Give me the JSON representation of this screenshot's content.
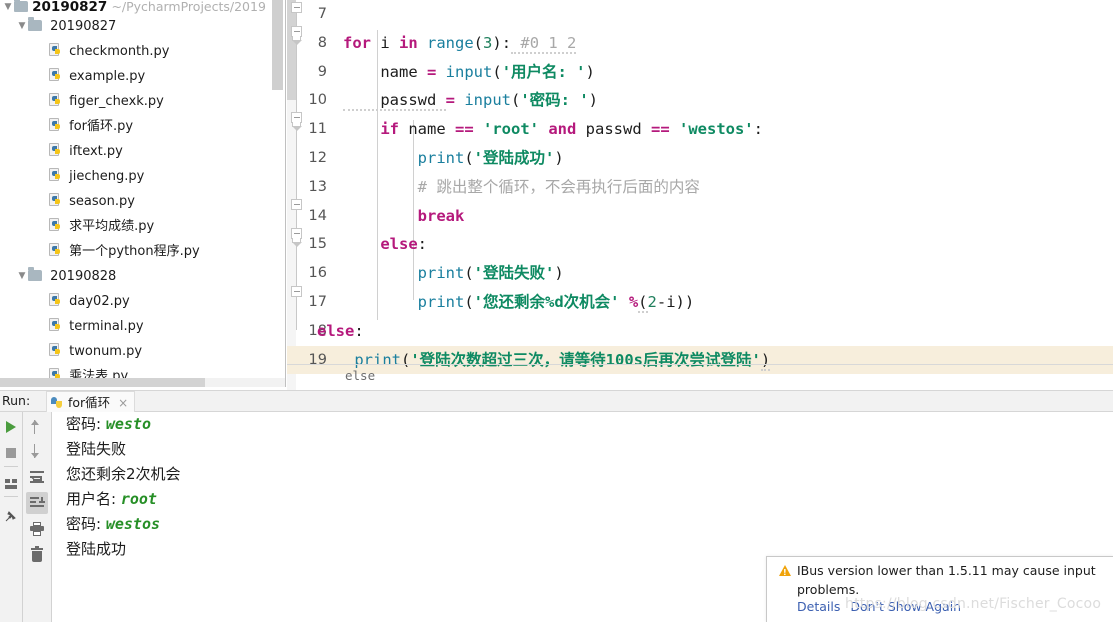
{
  "project": {
    "root": {
      "name": "20190827",
      "path": "~/PycharmProjects/2019",
      "arrow": "chevron-down-icon"
    },
    "nodes": [
      {
        "type": "folder",
        "label": "20190827",
        "indent": 1,
        "arrow": "chevron-down-icon"
      },
      {
        "type": "file",
        "label": "checkmonth.py",
        "indent": 2
      },
      {
        "type": "file",
        "label": "example.py",
        "indent": 2
      },
      {
        "type": "file",
        "label": "figer_chexk.py",
        "indent": 2
      },
      {
        "type": "file",
        "label": "for循环.py",
        "indent": 2
      },
      {
        "type": "file",
        "label": "iftext.py",
        "indent": 2
      },
      {
        "type": "file",
        "label": "jiecheng.py",
        "indent": 2
      },
      {
        "type": "file",
        "label": "season.py",
        "indent": 2
      },
      {
        "type": "file",
        "label": "求平均成绩.py",
        "indent": 2
      },
      {
        "type": "file",
        "label": "第一个python程序.py",
        "indent": 2
      },
      {
        "type": "folder",
        "label": "20190828",
        "indent": 1,
        "arrow": "chevron-down-icon"
      },
      {
        "type": "file",
        "label": "day02.py",
        "indent": 2
      },
      {
        "type": "file",
        "label": "terminal.py",
        "indent": 2
      },
      {
        "type": "file",
        "label": "twonum.py",
        "indent": 2
      },
      {
        "type": "file",
        "label": "乘法表.py",
        "indent": 2
      }
    ]
  },
  "editor": {
    "lines": [
      {
        "num": "7",
        "highlight": false
      },
      {
        "num": "8",
        "highlight": false
      },
      {
        "num": "9",
        "highlight": false
      },
      {
        "num": "10",
        "highlight": false
      },
      {
        "num": "11",
        "highlight": false
      },
      {
        "num": "12",
        "highlight": false
      },
      {
        "num": "13",
        "highlight": false
      },
      {
        "num": "14",
        "highlight": false
      },
      {
        "num": "15",
        "highlight": false
      },
      {
        "num": "16",
        "highlight": false
      },
      {
        "num": "17",
        "highlight": false
      },
      {
        "num": "18",
        "highlight": false
      },
      {
        "num": "19",
        "highlight": true
      }
    ],
    "source": {
      "l7": "",
      "l8_kw_for": "for",
      "l8_var_i": " i ",
      "l8_kw_in": "in",
      "l8_fn_range": " range",
      "l8_paren_open": "(",
      "l8_num3": "3",
      "l8_paren_close": ")",
      "l8_colon": ":",
      "l8_comment": " #0 1 2",
      "l9_name": "    name ",
      "l9_eq": "=",
      "l9_input": " input",
      "l9_p1": "(",
      "l9_str": "'用户名: '",
      "l9_p2": ")",
      "l10_passwd": "    passwd ",
      "l10_eq": "=",
      "l10_input": " input",
      "l10_p1": "(",
      "l10_str": "'密码: '",
      "l10_p2": ")",
      "l11_if": "    if",
      "l11_name": " name ",
      "l11_eqeq": "==",
      "l11_root": " 'root' ",
      "l11_and": "and",
      "l11_passwd": " passwd ",
      "l11_eqeq2": "==",
      "l11_westos": " 'westos'",
      "l11_colon": ":",
      "l12_print": "        print",
      "l12_p1": "(",
      "l12_str": "'登陆成功'",
      "l12_p2": ")",
      "l13_comment": "        # 跳出整个循环，不会再执行后面的内容",
      "l14_break": "        break",
      "l15_else": "    else",
      "l15_colon": ":",
      "l16_print": "        print",
      "l16_p1": "(",
      "l16_str": "'登陆失败'",
      "l16_p2": ")",
      "l17_print": "        print",
      "l17_p1": "(",
      "l17_str": "'您还剩余%d次机会'",
      "l17_pct": " %",
      "l17_p2": "(",
      "l17_num2": "2",
      "l17_minus": "-",
      "l17_i": "i",
      "l17_p3": "))",
      "l18_else": "else",
      "l18_colon": ":",
      "l19_print": "    print",
      "l19_p1": "(",
      "l19_str": "'登陆次数超过三次，请等待100s后再次尝试登陆'",
      "l19_p2": ")",
      "after": "else"
    }
  },
  "run_panel": {
    "label": "Run:",
    "tab_name": "for循环",
    "tab_close": "×",
    "toolbar_left": [
      {
        "name": "run-button",
        "icon": "play-icon"
      },
      {
        "name": "stop-button",
        "icon": "stop-icon"
      },
      {
        "name": "layout-button",
        "icon": "layout-icon"
      },
      {
        "name": "pin-button",
        "icon": "pin-icon"
      }
    ],
    "toolbar_right": [
      {
        "name": "up-button",
        "icon": "arrow-up-icon"
      },
      {
        "name": "down-button",
        "icon": "arrow-down-icon"
      },
      {
        "name": "soft-wrap-button",
        "icon": "soft-wrap-icon"
      },
      {
        "name": "scroll-to-end-button",
        "icon": "scroll-to-end-icon",
        "active": true
      },
      {
        "name": "print-button",
        "icon": "print-icon"
      },
      {
        "name": "clear-all-button",
        "icon": "trash-icon"
      }
    ],
    "console": [
      {
        "prompt": "密码: ",
        "input": "westo"
      },
      {
        "prompt": "登陆失败",
        "input": ""
      },
      {
        "prompt": "您还剩余2次机会",
        "input": ""
      },
      {
        "prompt": "用户名: ",
        "input": "root"
      },
      {
        "prompt": "密码: ",
        "input": "westos"
      },
      {
        "prompt": "登陆成功",
        "input": ""
      },
      {
        "prompt": "",
        "input": ""
      },
      {
        "prompt": "",
        "input": ""
      }
    ]
  },
  "notification": {
    "icon": "warning-icon",
    "message": "IBus version lower than 1.5.11 may cause input problems.",
    "details_link": "Details",
    "dont_show_link": "Don't Show Again"
  },
  "watermark": "https://blog.csdn.net/Fischer_Cocoo",
  "colors": {
    "keyword": "#b5197c",
    "string": "#0e8a62",
    "function": "#1a7f9e",
    "number": "#1f7f5c",
    "comment": "#a8a8a8",
    "highlight_line": "#f7eedc",
    "console_input": "#268f26",
    "link": "#3b5fb0",
    "warning": "#f0a30a"
  }
}
